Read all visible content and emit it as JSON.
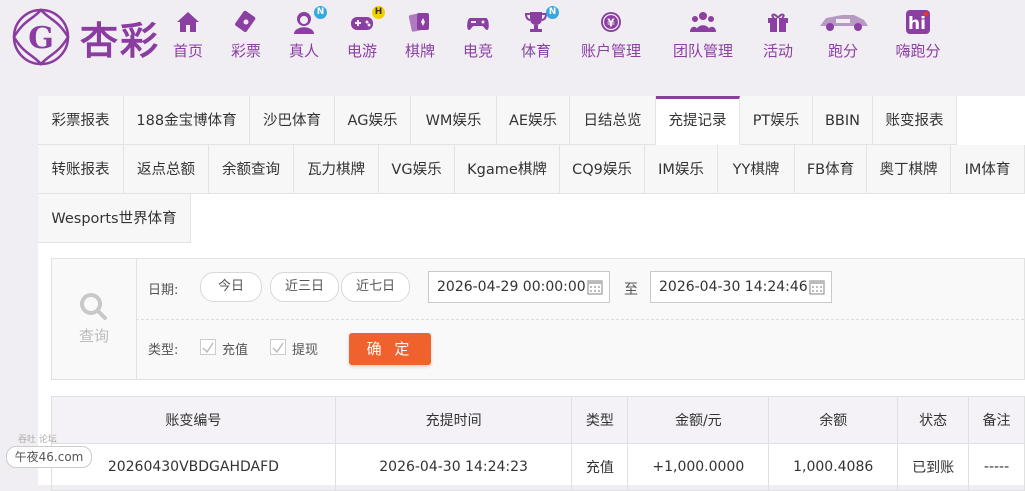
{
  "brand": {
    "name": "杏彩",
    "logo_icon": "flower-logo-icon",
    "accent": "#8a3ca0"
  },
  "nav": [
    {
      "label": "首页",
      "icon": "home-icon"
    },
    {
      "label": "彩票",
      "icon": "lottery-ticket-icon"
    },
    {
      "label": "真人",
      "icon": "live-dealer-icon",
      "badge": "N"
    },
    {
      "label": "电游",
      "icon": "gamepad-icon",
      "badge": "H"
    },
    {
      "label": "棋牌",
      "icon": "cards-icon"
    },
    {
      "label": "电竞",
      "icon": "controller-icon"
    },
    {
      "label": "体育",
      "icon": "trophy-icon",
      "badge": "N"
    },
    {
      "label": "账户管理",
      "icon": "yen-coin-icon"
    },
    {
      "label": "团队管理",
      "icon": "team-icon"
    },
    {
      "label": "活动",
      "icon": "gift-icon"
    },
    {
      "label": "跑分",
      "icon": "car-icon"
    },
    {
      "label": "嗨跑分",
      "icon": "hi-icon"
    }
  ],
  "tabs": [
    "彩票报表",
    "188金宝博体育",
    "沙巴体育",
    "AG娱乐",
    "WM娱乐",
    "AE娱乐",
    "日结总览",
    "充提记录",
    "PT娱乐",
    "BBIN",
    "账变报表",
    "转账报表",
    "返点总额",
    "余额查询",
    "瓦力棋牌",
    "VG娱乐",
    "Kgame棋牌",
    "CQ9娱乐",
    "IM娱乐",
    "YY棋牌",
    "FB体育",
    "奥丁棋牌",
    "IM体育",
    "Wesports世界体育"
  ],
  "active_tab": "充提记录",
  "filter": {
    "search_label": "查询",
    "date_label": "日期:",
    "quick": [
      "今日",
      "近三日",
      "近七日"
    ],
    "start": "2026-04-29 00:00:00",
    "to": "至",
    "end": "2026-04-30 14:24:46",
    "type_label": "类型:",
    "types": [
      "充值",
      "提现"
    ],
    "submit": "确 定"
  },
  "table": {
    "headers": [
      "账变编号",
      "充提时间",
      "类型",
      "金额/元",
      "余额",
      "状态",
      "备注"
    ],
    "rows": [
      [
        "20260430VBDGAHDAFD",
        "2026-04-30 14:24:23",
        "充值",
        "+1,000.0000",
        "1,000.4086",
        "已到账",
        "-----"
      ]
    ]
  },
  "watermark": {
    "top": "吞吐  论坛",
    "text": "午夜46.com"
  }
}
